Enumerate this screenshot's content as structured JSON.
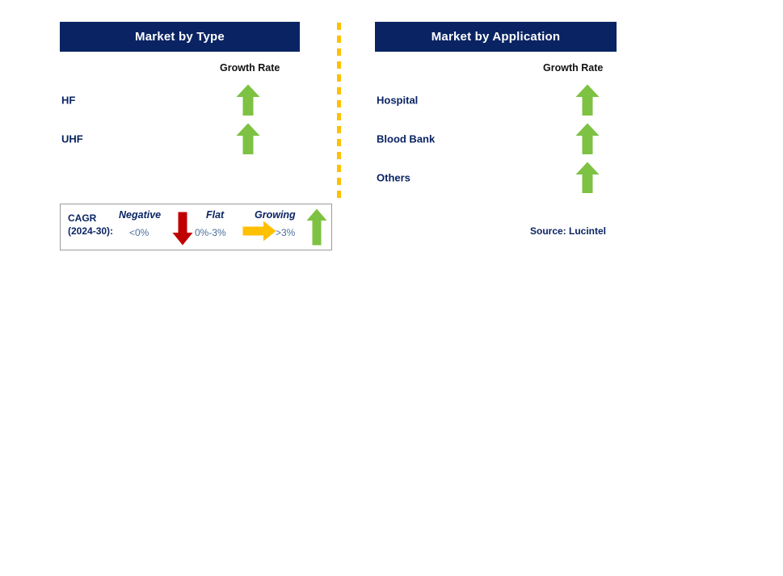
{
  "panels": [
    {
      "id": "type",
      "title": "Market by Type",
      "growth_rate_header": "Growth Rate",
      "segments": [
        {
          "label": "HF",
          "trend": "growing",
          "trend_icon": "arrow-up-icon"
        },
        {
          "label": "UHF",
          "trend": "growing",
          "trend_icon": "arrow-up-icon"
        }
      ]
    },
    {
      "id": "application",
      "title": "Market by Application",
      "growth_rate_header": "Growth Rate",
      "segments": [
        {
          "label": "Hospital",
          "trend": "growing",
          "trend_icon": "arrow-up-icon"
        },
        {
          "label": "Blood Bank",
          "trend": "growing",
          "trend_icon": "arrow-up-icon"
        },
        {
          "label": "Others",
          "trend": "growing",
          "trend_icon": "arrow-up-icon"
        }
      ]
    }
  ],
  "legend": {
    "title_line1": "CAGR",
    "title_line2": "(2024-30):",
    "entries": [
      {
        "word": "Negative",
        "range": "<0%",
        "icon": "arrow-down-icon",
        "color": "#C00000"
      },
      {
        "word": "Flat",
        "range": "0%-3%",
        "icon": "arrow-right-icon",
        "color": "#FFC000"
      },
      {
        "word": "Growing",
        "range": ">3%",
        "icon": "arrow-up-icon",
        "color": "#7DC242"
      }
    ]
  },
  "source": "Source: Lucintel",
  "colors": {
    "header_navy": "#0A2463",
    "label_navy": "#0A2463",
    "growing_green": "#7DC242",
    "negative_red": "#C00000",
    "flat_orange": "#FFC000",
    "divider_amber": "#FFC000",
    "range_text_blue": "#4a6f99"
  }
}
